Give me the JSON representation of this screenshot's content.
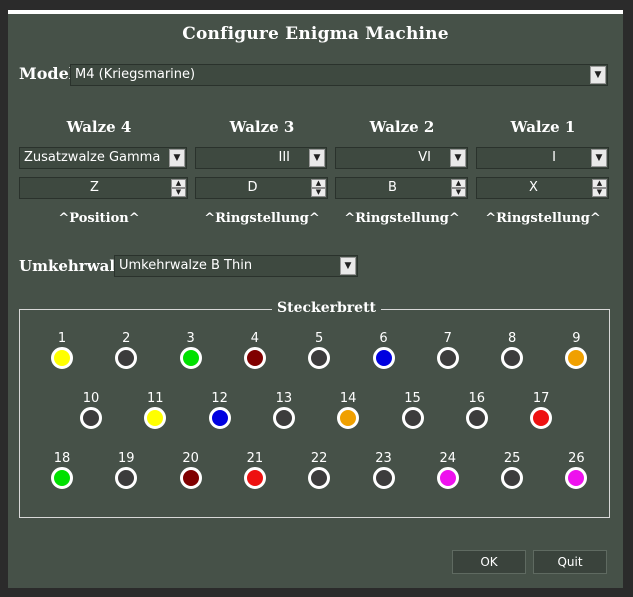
{
  "window": {
    "title": "Configure Enigma Machine"
  },
  "model": {
    "label": "Model",
    "value": "M4 (Kriegsmarine)"
  },
  "walzen": [
    {
      "label": "Walze 4",
      "rotor": "Zusatzwalze Gamma",
      "position": "Z",
      "sublabel": "^Position^"
    },
    {
      "label": "Walze 3",
      "rotor": "III",
      "position": "D",
      "sublabel": "^Ringstellung^"
    },
    {
      "label": "Walze 2",
      "rotor": "VI",
      "position": "B",
      "sublabel": "^Ringstellung^"
    },
    {
      "label": "Walze 1",
      "rotor": "I",
      "position": "X",
      "sublabel": "^Ringstellung^"
    }
  ],
  "umkehrwalze": {
    "label": "Umkehrwalze",
    "value": "Umkehrwalze B Thin"
  },
  "steckerbrett": {
    "title": "Steckerbrett",
    "plugs": [
      {
        "num": "1",
        "color": "#ffff00"
      },
      {
        "num": "2",
        "color": "#3c3c3c"
      },
      {
        "num": "3",
        "color": "#00e000"
      },
      {
        "num": "4",
        "color": "#800000"
      },
      {
        "num": "5",
        "color": "#3c3c3c"
      },
      {
        "num": "6",
        "color": "#0000e0"
      },
      {
        "num": "7",
        "color": "#3c3c3c"
      },
      {
        "num": "8",
        "color": "#3c3c3c"
      },
      {
        "num": "9",
        "color": "#f0a000"
      },
      {
        "num": "10",
        "color": "#3c3c3c"
      },
      {
        "num": "11",
        "color": "#ffff00"
      },
      {
        "num": "12",
        "color": "#0000e0"
      },
      {
        "num": "13",
        "color": "#3c3c3c"
      },
      {
        "num": "14",
        "color": "#f0a000"
      },
      {
        "num": "15",
        "color": "#3c3c3c"
      },
      {
        "num": "16",
        "color": "#3c3c3c"
      },
      {
        "num": "17",
        "color": "#ee1111"
      },
      {
        "num": "18",
        "color": "#00e000"
      },
      {
        "num": "19",
        "color": "#3c3c3c"
      },
      {
        "num": "20",
        "color": "#800000"
      },
      {
        "num": "21",
        "color": "#ee1111"
      },
      {
        "num": "22",
        "color": "#3c3c3c"
      },
      {
        "num": "23",
        "color": "#3c3c3c"
      },
      {
        "num": "24",
        "color": "#ee11ee"
      },
      {
        "num": "25",
        "color": "#3c3c3c"
      },
      {
        "num": "26",
        "color": "#ee11ee"
      }
    ]
  },
  "buttons": {
    "ok": "OK",
    "quit": "Quit"
  }
}
